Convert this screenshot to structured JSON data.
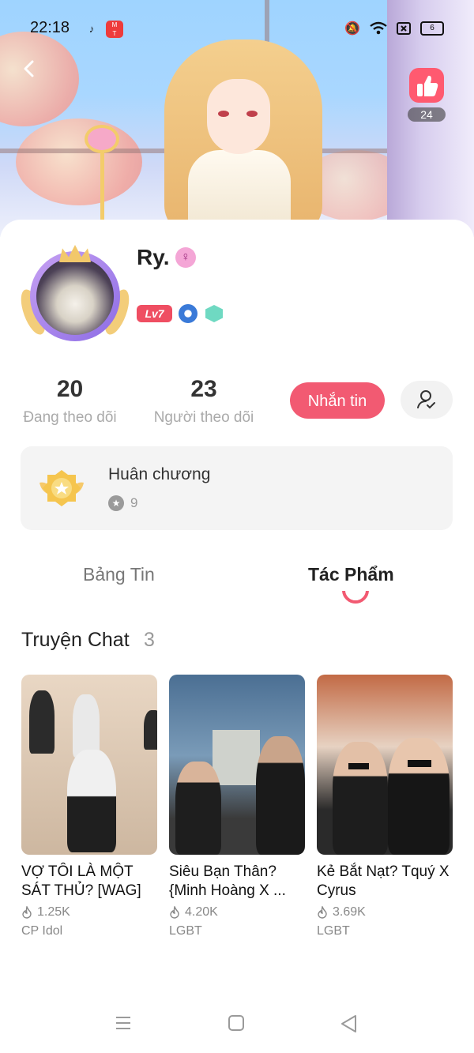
{
  "status_bar": {
    "time": "22:18",
    "battery": "6",
    "icons": [
      "tiktok-icon",
      "mangatoon-icon",
      "mute-vibrate-icon",
      "wifi-icon",
      "sim-icon",
      "battery-icon"
    ]
  },
  "banner": {
    "like_count": "24"
  },
  "profile": {
    "username": "Ry.",
    "level": "Lv7",
    "following_count": "20",
    "following_label": "Đang theo dõi",
    "followers_count": "23",
    "followers_label": "Người theo dõi",
    "message_button": "Nhắn tin"
  },
  "medals": {
    "title": "Huân chương",
    "count": "9"
  },
  "tabs": [
    {
      "label": "Bảng Tin",
      "active": false
    },
    {
      "label": "Tác Phẩm",
      "active": true
    }
  ],
  "section": {
    "title": "Truyện Chat",
    "count": "3"
  },
  "stories": [
    {
      "title": "VỢ TÔI LÀ MỘT SÁT THỦ? [WAG]",
      "views": "1.25K",
      "category": "CP Idol"
    },
    {
      "title": "Siêu Bạn Thân? {Minh Hoàng X ...",
      "views": "4.20K",
      "category": "LGBT"
    },
    {
      "title": "Kẻ Bắt Nạt? Tquý X Cyrus",
      "views": "3.69K",
      "category": "LGBT"
    }
  ],
  "colors": {
    "accent": "#f25a72",
    "level_badge": "#ef4e62"
  }
}
